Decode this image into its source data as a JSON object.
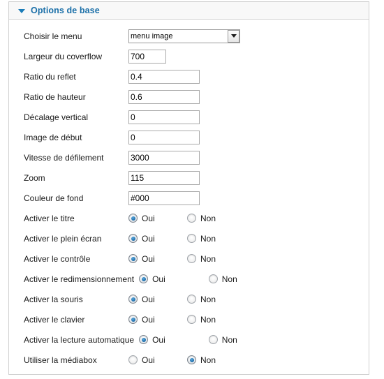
{
  "panel": {
    "title": "Options de base",
    "collapse_icon": "triangle-down-icon",
    "accent_color": "#1a6fa8"
  },
  "fields": {
    "menu": {
      "label": "Choisir le menu",
      "type": "select",
      "value": "menu image",
      "options": [
        "menu image"
      ]
    },
    "width": {
      "label": "Largeur du coverflow",
      "type": "text",
      "value": "700"
    },
    "reflection_ratio": {
      "label": "Ratio du reflet",
      "type": "text",
      "value": "0.4"
    },
    "height_ratio": {
      "label": "Ratio de hauteur",
      "type": "text",
      "value": "0.6"
    },
    "vertical_offset": {
      "label": "Décalage vertical",
      "type": "text",
      "value": "0"
    },
    "start_image": {
      "label": "Image de début",
      "type": "text",
      "value": "0"
    },
    "scroll_speed": {
      "label": "Vitesse de défilement",
      "type": "text",
      "value": "3000"
    },
    "zoom": {
      "label": "Zoom",
      "type": "text",
      "value": "115"
    },
    "background_color": {
      "label": "Couleur de fond",
      "type": "text",
      "value": "#000"
    },
    "enable_title": {
      "label": "Activer le titre",
      "type": "radio",
      "yes_label": "Oui",
      "no_label": "Non",
      "selected": "Oui"
    },
    "enable_fullscreen": {
      "label": "Activer le plein écran",
      "type": "radio",
      "yes_label": "Oui",
      "no_label": "Non",
      "selected": "Oui"
    },
    "enable_control": {
      "label": "Activer le contrôle",
      "type": "radio",
      "yes_label": "Oui",
      "no_label": "Non",
      "selected": "Oui"
    },
    "enable_resize": {
      "label": "Activer le redimensionnement",
      "type": "radio",
      "yes_label": "Oui",
      "no_label": "Non",
      "selected": "Oui"
    },
    "enable_mouse": {
      "label": "Activer la souris",
      "type": "radio",
      "yes_label": "Oui",
      "no_label": "Non",
      "selected": "Oui"
    },
    "enable_keyboard": {
      "label": "Activer le clavier",
      "type": "radio",
      "yes_label": "Oui",
      "no_label": "Non",
      "selected": "Oui"
    },
    "enable_autoplay": {
      "label": "Activer la lecture automatique",
      "type": "radio",
      "yes_label": "Oui",
      "no_label": "Non",
      "selected": "Oui"
    },
    "use_mediabox": {
      "label": "Utiliser la médiabox",
      "type": "radio",
      "yes_label": "Oui",
      "no_label": "Non",
      "selected": "Non"
    }
  }
}
